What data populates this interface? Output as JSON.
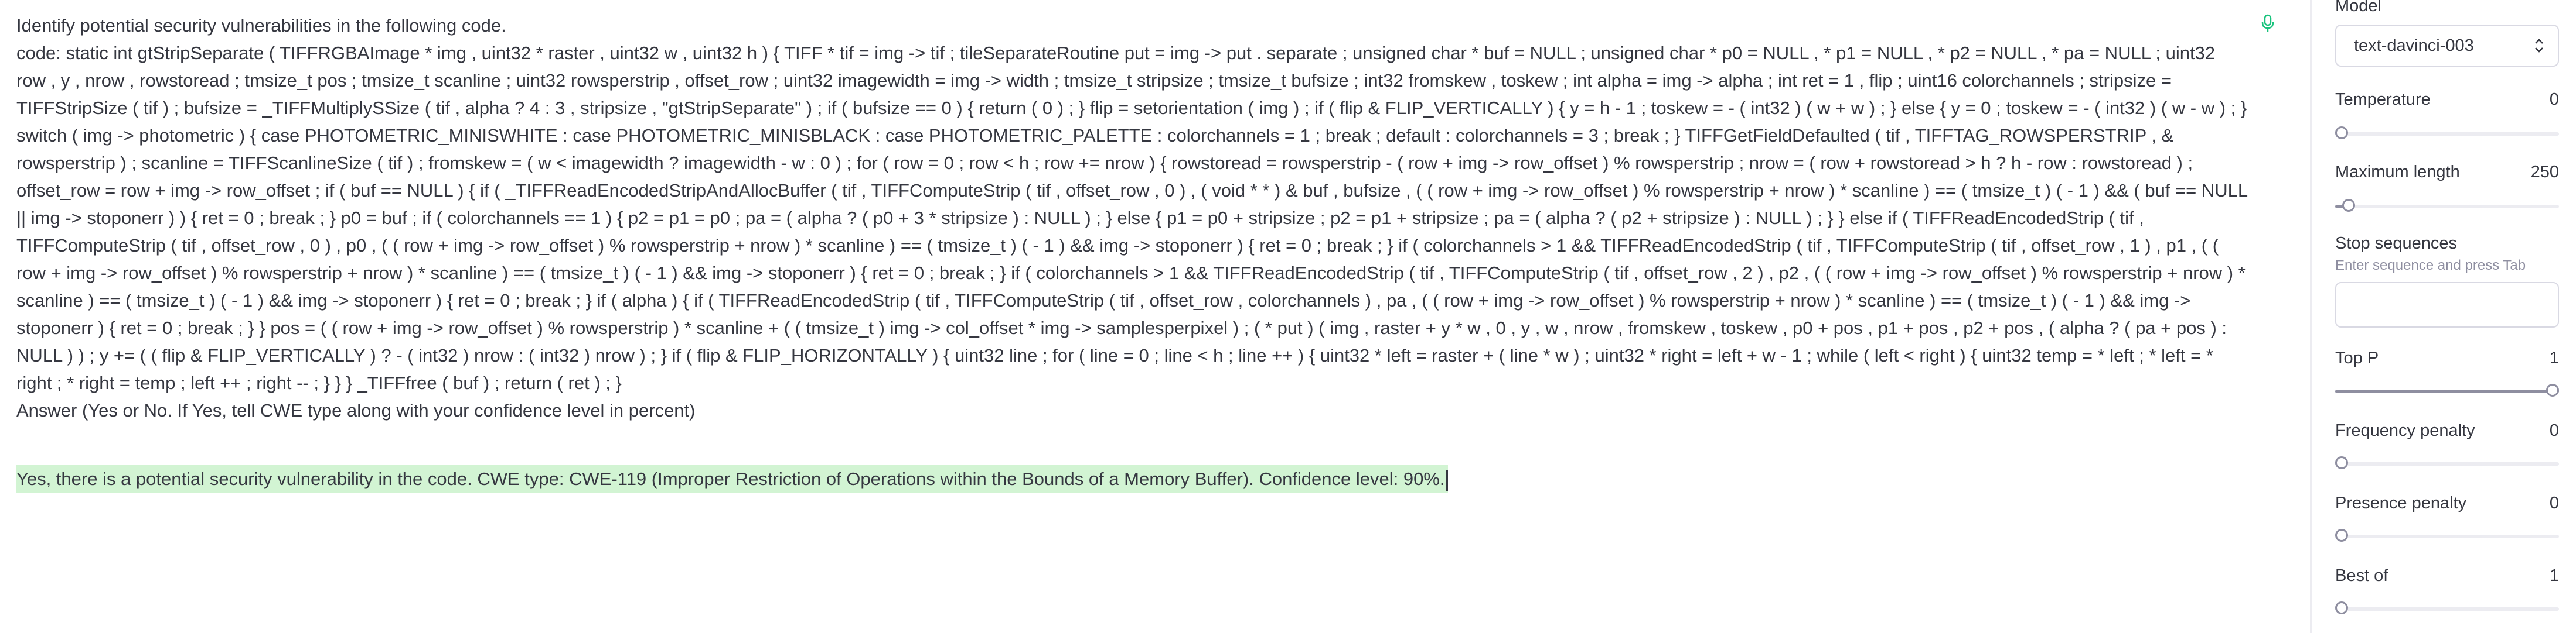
{
  "prompt": {
    "text": "Identify potential security vulnerabilities in the following code.\ncode: static int gtStripSeparate ( TIFFRGBAImage * img , uint32 * raster , uint32 w , uint32 h ) { TIFF * tif = img -> tif ; tileSeparateRoutine put = img -> put . separate ; unsigned char * buf = NULL ; unsigned char * p0 = NULL , * p1 = NULL , * p2 = NULL , * pa = NULL ; uint32 row , y , nrow , rowstoread ; tmsize_t pos ; tmsize_t scanline ; uint32 rowsperstrip , offset_row ; uint32 imagewidth = img -> width ; tmsize_t stripsize ; tmsize_t bufsize ; int32 fromskew , toskew ; int alpha = img -> alpha ; int ret = 1 , flip ; uint16 colorchannels ; stripsize = TIFFStripSize ( tif ) ; bufsize = _TIFFMultiplySSize ( tif , alpha ? 4 : 3 , stripsize , \"gtStripSeparate\" ) ; if ( bufsize == 0 ) { return ( 0 ) ; } flip = setorientation ( img ) ; if ( flip & FLIP_VERTICALLY ) { y = h - 1 ; toskew = - ( int32 ) ( w + w ) ; } else { y = 0 ; toskew = - ( int32 ) ( w - w ) ; } switch ( img -> photometric ) { case PHOTOMETRIC_MINISWHITE : case PHOTOMETRIC_MINISBLACK : case PHOTOMETRIC_PALETTE : colorchannels = 1 ; break ; default : colorchannels = 3 ; break ; } TIFFGetFieldDefaulted ( tif , TIFFTAG_ROWSPERSTRIP , & rowsperstrip ) ; scanline = TIFFScanlineSize ( tif ) ; fromskew = ( w < imagewidth ? imagewidth - w : 0 ) ; for ( row = 0 ; row < h ; row += nrow ) { rowstoread = rowsperstrip - ( row + img -> row_offset ) % rowsperstrip ; nrow = ( row + rowstoread > h ? h - row : rowstoread ) ; offset_row = row + img -> row_offset ; if ( buf == NULL ) { if ( _TIFFReadEncodedStripAndAllocBuffer ( tif , TIFFComputeStrip ( tif , offset_row , 0 ) , ( void * * ) & buf , bufsize , ( ( row + img -> row_offset ) % rowsperstrip + nrow ) * scanline ) == ( tmsize_t ) ( - 1 ) && ( buf == NULL || img -> stoponerr ) ) { ret = 0 ; break ; } p0 = buf ; if ( colorchannels == 1 ) { p2 = p1 = p0 ; pa = ( alpha ? ( p0 + 3 * stripsize ) : NULL ) ; } else { p1 = p0 + stripsize ; p2 = p1 + stripsize ; pa = ( alpha ? ( p2 + stripsize ) : NULL ) ; } } else if ( TIFFReadEncodedStrip ( tif , TIFFComputeStrip ( tif , offset_row , 0 ) , p0 , ( ( row + img -> row_offset ) % rowsperstrip + nrow ) * scanline ) == ( tmsize_t ) ( - 1 ) && img -> stoponerr ) { ret = 0 ; break ; } if ( colorchannels > 1 && TIFFReadEncodedStrip ( tif , TIFFComputeStrip ( tif , offset_row , 1 ) , p1 , ( ( row + img -> row_offset ) % rowsperstrip + nrow ) * scanline ) == ( tmsize_t ) ( - 1 ) && img -> stoponerr ) { ret = 0 ; break ; } if ( colorchannels > 1 && TIFFReadEncodedStrip ( tif , TIFFComputeStrip ( tif , offset_row , 2 ) , p2 , ( ( row + img -> row_offset ) % rowsperstrip + nrow ) * scanline ) == ( tmsize_t ) ( - 1 ) && img -> stoponerr ) { ret = 0 ; break ; } if ( alpha ) { if ( TIFFReadEncodedStrip ( tif , TIFFComputeStrip ( tif , offset_row , colorchannels ) , pa , ( ( row + img -> row_offset ) % rowsperstrip + nrow ) * scanline ) == ( tmsize_t ) ( - 1 ) && img -> stoponerr ) { ret = 0 ; break ; } } pos = ( ( row + img -> row_offset ) % rowsperstrip ) * scanline + ( ( tmsize_t ) img -> col_offset * img -> samplesperpixel ) ; ( * put ) ( img , raster + y * w , 0 , y , w , nrow , fromskew , toskew , p0 + pos , p1 + pos , p2 + pos , ( alpha ? ( pa + pos ) : NULL ) ) ; y += ( ( flip & FLIP_VERTICALLY ) ? - ( int32 ) nrow : ( int32 ) nrow ) ; } if ( flip & FLIP_HORIZONTALLY ) { uint32 line ; for ( line = 0 ; line < h ; line ++ ) { uint32 * left = raster + ( line * w ) ; uint32 * right = left + w - 1 ; while ( left < right ) { uint32 temp = * left ; * left = * right ; * right = temp ; left ++ ; right -- ; } } } _TIFFfree ( buf ) ; return ( ret ) ; }\nAnswer (Yes or No. If Yes, tell CWE type along with your confidence level in percent)",
    "completion": "Yes, there is a potential security vulnerability in the code. CWE type: CWE-119 (Improper Restriction of Operations within the Bounds of a Memory Buffer). Confidence level: 90%."
  },
  "sidebar": {
    "model": {
      "label": "Model",
      "value": "text-davinci-003"
    },
    "temperature": {
      "label": "Temperature",
      "value": "0",
      "level": 0.0
    },
    "max_length": {
      "label": "Maximum length",
      "value": "250",
      "level": 0.06
    },
    "stop_sequences": {
      "label": "Stop sequences",
      "hint": "Enter sequence and press Tab"
    },
    "top_p": {
      "label": "Top P",
      "value": "1",
      "level": 1.0
    },
    "frequency_penalty": {
      "label": "Frequency penalty",
      "value": "0",
      "level": 0.0
    },
    "presence_penalty": {
      "label": "Presence penalty",
      "value": "0",
      "level": 0.0
    },
    "best_of": {
      "label": "Best of",
      "value": "1",
      "level": 0.0
    }
  },
  "colors": {
    "completion_highlight": "#d2f4d3",
    "mic_icon": "#19c37d"
  },
  "icons": {
    "mic": "microphone-icon",
    "chevron": "chevron-updown-icon"
  }
}
